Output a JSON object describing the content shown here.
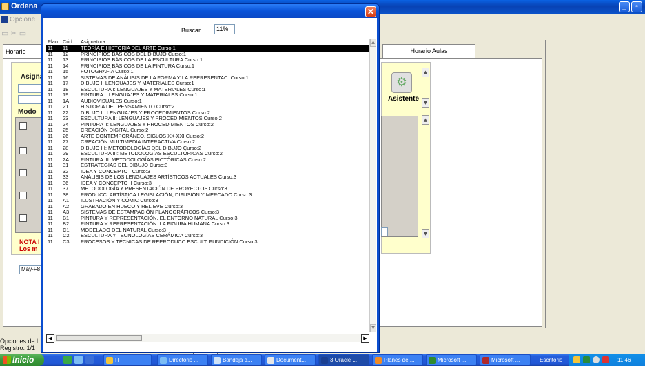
{
  "app": {
    "title": "Ordena",
    "menu_label": "Opcione",
    "tab_left": "Horario",
    "tab_right": "Horario Aulas",
    "labels": {
      "asigna": "Asigna",
      "modo": "Modo",
      "nota": "NOTA I",
      "los": "Los m",
      "asistente": "Asistente"
    },
    "combo_value": "May-F8",
    "status": {
      "opciones": "Opciones de l",
      "registro": "Registro: 1/1"
    }
  },
  "dialog": {
    "search_label": "Buscar",
    "search_value": "11%",
    "columns": {
      "plan": "Plan",
      "cod": "Cód",
      "asignatura": "Asignatura"
    },
    "rows": [
      {
        "plan": "11",
        "cod": "11",
        "asignatura": "TEORÍA E HISTORIA DEL ARTE Curso:1"
      },
      {
        "plan": "11",
        "cod": "12",
        "asignatura": "PRINCIPIOS BÁSICOS DEL DIBUJO Curso:1"
      },
      {
        "plan": "11",
        "cod": "13",
        "asignatura": "PRINCIPIOS BÁSICOS DE LA ESCULTURA Curso:1"
      },
      {
        "plan": "11",
        "cod": "14",
        "asignatura": "PRINCIPIOS BÁSICOS DE LA PINTURA Curso:1"
      },
      {
        "plan": "11",
        "cod": "15",
        "asignatura": "FOTOGRAFÍA Curso:1"
      },
      {
        "plan": "11",
        "cod": "16",
        "asignatura": "SISTEMAS DE ANÁLISIS DE LA FORMA Y LA REPRESENTAC. Curso:1"
      },
      {
        "plan": "11",
        "cod": "17",
        "asignatura": "DIBUJO I: LENGUAJES Y MATERIALES Curso:1"
      },
      {
        "plan": "11",
        "cod": "18",
        "asignatura": "ESCULTURA I: LENGUAJES Y MATERIALES Curso:1"
      },
      {
        "plan": "11",
        "cod": "19",
        "asignatura": "PINTURA I: LENGUAJES Y MATERIALES Curso:1"
      },
      {
        "plan": "11",
        "cod": "1A",
        "asignatura": "AUDIOVISUALES Curso:1"
      },
      {
        "plan": "11",
        "cod": "21",
        "asignatura": "HISTORIA DEL PENSAMIENTO Curso:2"
      },
      {
        "plan": "11",
        "cod": "22",
        "asignatura": "DIBUJO II: LENGUAJES Y PROCEDIMIENTOS Curso:2"
      },
      {
        "plan": "11",
        "cod": "23",
        "asignatura": "ESCULTURA II: LENGUAJES Y PROCEDIMIENTOS Curso:2"
      },
      {
        "plan": "11",
        "cod": "24",
        "asignatura": "PINTURA II: LENGUAJES Y PROCEDIMIENTOS Curso:2"
      },
      {
        "plan": "11",
        "cod": "25",
        "asignatura": "CREACIÓN DIGITAL Curso:2"
      },
      {
        "plan": "11",
        "cod": "26",
        "asignatura": "ARTE CONTEMPORÁNEO. SIGLOS XX-XXI Curso:2"
      },
      {
        "plan": "11",
        "cod": "27",
        "asignatura": "CREACIÓN MULTIMEDIA INTERACTIVA Curso:2"
      },
      {
        "plan": "11",
        "cod": "28",
        "asignatura": "DIBUJO III: METODOLOGÍAS DEL DIBUJO Curso:2"
      },
      {
        "plan": "11",
        "cod": "29",
        "asignatura": "ESCULTURA III: METODOLOGÍAS ESCULTÓRICAS Curso:2"
      },
      {
        "plan": "11",
        "cod": "2A",
        "asignatura": "PINTURA III: METODOLOGÍAS PICTÓRICAS Curso:2"
      },
      {
        "plan": "11",
        "cod": "31",
        "asignatura": "ESTRATEGIAS DEL DIBUJO Curso:3"
      },
      {
        "plan": "11",
        "cod": "32",
        "asignatura": "IDEA Y CONCEPTO I Curso:3"
      },
      {
        "plan": "11",
        "cod": "33",
        "asignatura": "ANÁLISIS DE LOS LENGUAJES ARTÍSTICOS ACTUALES Curso:3"
      },
      {
        "plan": "11",
        "cod": "36",
        "asignatura": "IDEA Y CONCEPTO II Curso:3"
      },
      {
        "plan": "11",
        "cod": "37",
        "asignatura": "METODOLOGÍA Y PRESENTACIÓN DE PROYECTOS Curso:3"
      },
      {
        "plan": "11",
        "cod": "38",
        "asignatura": "PRODUCC. ARTÍSTICA:LEGISLACIÓN, DIFUSIÓN Y MERCADO Curso:3"
      },
      {
        "plan": "11",
        "cod": "A1",
        "asignatura": "ILUSTRACIÓN Y CÓMIC Curso:3"
      },
      {
        "plan": "11",
        "cod": "A2",
        "asignatura": "GRABADO EN HUECO Y RELIEVE Curso:3"
      },
      {
        "plan": "11",
        "cod": "A3",
        "asignatura": "SISTEMAS DE ESTAMPACIÓN PLANOGRÁFICOS Curso:3"
      },
      {
        "plan": "11",
        "cod": "B1",
        "asignatura": "PINTURA Y REPRESENTACIÓN. EL ENTORNO NATURAL Curso:3"
      },
      {
        "plan": "11",
        "cod": "B2",
        "asignatura": "PINTURA Y REPRESENTACIÓN. LA FIGURA HUMANA Curso:3"
      },
      {
        "plan": "11",
        "cod": "C1",
        "asignatura": "MODELADO DEL NATURAL Curso:3"
      },
      {
        "plan": "11",
        "cod": "C2",
        "asignatura": "ESCULTURA Y TECNOLOGÍAS CERÁMICA Curso:3"
      },
      {
        "plan": "11",
        "cod": "C3",
        "asignatura": "PROCESOS Y TÉCNICAS DE REPRODUCC.ESCULT: FUNDICIÓN Curso:3"
      }
    ],
    "selected_index": 0
  },
  "taskbar": {
    "start_label": "Inicio",
    "buttons": [
      {
        "label": "IT",
        "icon": "folder-icon",
        "color": "#f3c53a"
      },
      {
        "label": "Directorio ...",
        "icon": "ie-icon",
        "color": "#7bbcf5"
      },
      {
        "label": "Bandeja d...",
        "icon": "mail-icon",
        "color": "#cfe2f7"
      },
      {
        "label": "Document...",
        "icon": "document-icon",
        "color": "#e6e6e6"
      },
      {
        "label": "3 Oracle ...",
        "icon": "oracle-icon",
        "color": "#1b3f91",
        "active": true
      },
      {
        "label": "Planes de ...",
        "icon": "firefox-icon",
        "color": "#f08a24"
      },
      {
        "label": "Microsoft ...",
        "icon": "excel-icon",
        "color": "#2f8a2f"
      },
      {
        "label": "Microsoft ...",
        "icon": "access-icon",
        "color": "#b02a2a"
      }
    ],
    "escritorio": "Escritorio",
    "clock": "11:46"
  }
}
